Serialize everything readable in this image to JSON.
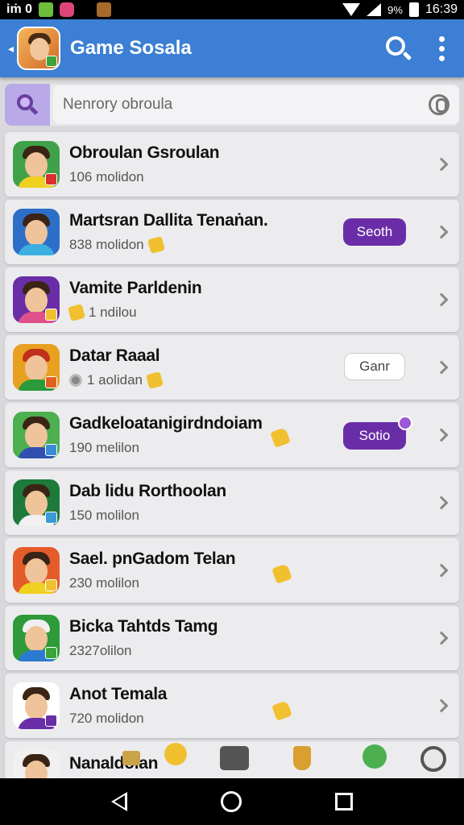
{
  "status_bar": {
    "left_text": "iṁ 0",
    "battery": "9%",
    "time": "16:39"
  },
  "app_bar": {
    "title": "Game Sosala"
  },
  "search": {
    "placeholder": "Nenrory obroula"
  },
  "colors": {
    "app_bar": "#3c7fd4",
    "accent_purple": "#6a2da8",
    "background": "#d9d9dc"
  },
  "contacts": [
    {
      "name": "Obroulan Gsroulan",
      "sub": "106 molidon",
      "avatar_bg": "#3fa24a"
    },
    {
      "name": "Martsran Dallita Tenaṅan.",
      "sub": "838 molidon",
      "avatar_bg": "#2d6fc8",
      "badge": "Seoth",
      "badge_style": "purple"
    },
    {
      "name": "Vamite Parldenin",
      "sub": "1 ndilou",
      "avatar_bg": "#6a2da8"
    },
    {
      "name": "Datar Raaal",
      "sub": "1 aolidan",
      "avatar_bg": "#e8a020",
      "badge": "Ganr",
      "badge_style": "white"
    },
    {
      "name": "Gadkeloatanigirdndoiam",
      "sub": "190 melilon",
      "avatar_bg": "#4caf50",
      "badge": "Sotio",
      "badge_style": "purple"
    },
    {
      "name": "Dab lidu Rorthoolan",
      "sub": "150 molilon",
      "avatar_bg": "#1e7a3a"
    },
    {
      "name": "Sael. pnGadom Telan",
      "sub": "230 molilon",
      "avatar_bg": "#e45c2a"
    },
    {
      "name": "Bicka Tahtds Tamg",
      "sub": "2327olilon",
      "avatar_bg": "#2e9a3a"
    },
    {
      "name": "Anot Temala",
      "sub": "720 molidon",
      "avatar_bg": "#ffffff"
    },
    {
      "name": "Nanaldoian",
      "sub": "",
      "avatar_bg": "#f0f0f0"
    }
  ],
  "bottom_icons": [
    "chat-icon",
    "emoji-icon",
    "archive-icon",
    "trophy-icon",
    "badge-icon",
    "more-icon"
  ]
}
